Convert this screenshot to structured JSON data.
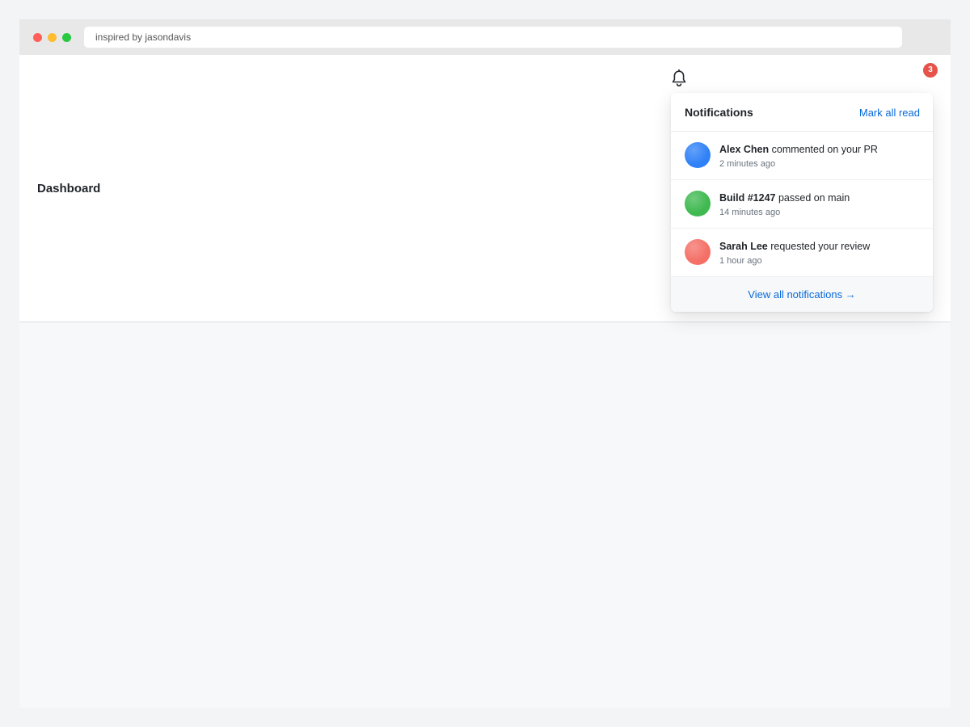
{
  "browser": {
    "url_text": "inspired by jasondavis",
    "traffic_lights": {
      "close": "#ff5f57",
      "minimize": "#febc2e",
      "zoom": "#28c840"
    }
  },
  "page": {
    "title": "Dashboard"
  },
  "notifications_bell": {
    "icon": "bell-icon",
    "badge_count": "3",
    "badge_color": "#e5534b"
  },
  "dropdown": {
    "title": "Notifications",
    "mark_all_read": "Mark all read",
    "items": [
      {
        "actor": "Alex Chen",
        "message": " commented on your PR",
        "time": "2 minutes ago",
        "avatar_color": "#2f81f7"
      },
      {
        "actor": "Build #1247",
        "message": " passed on main",
        "time": "14 minutes ago",
        "avatar_color": "#3fb950"
      },
      {
        "actor": "Sarah Lee",
        "message": " requested your review",
        "time": "1 hour ago",
        "avatar_color": "#f47067"
      }
    ],
    "view_all": "View all notifications →"
  }
}
